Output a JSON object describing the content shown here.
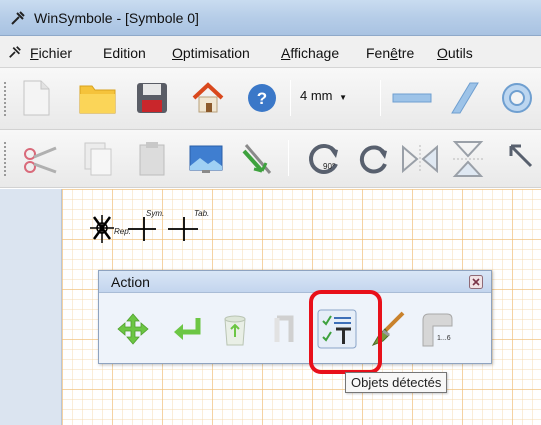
{
  "window": {
    "title": "WinSymbole - [Symbole 0]"
  },
  "menu": {
    "items": [
      {
        "label": "Fichier",
        "mnemonic_index": 0
      },
      {
        "label": "Edition",
        "mnemonic_index": -1
      },
      {
        "label": "Optimisation",
        "mnemonic_index": 0
      },
      {
        "label": "Affichage",
        "mnemonic_index": 0
      },
      {
        "label": "Fenêtre",
        "mnemonic_index": 3
      },
      {
        "label": "Outils",
        "mnemonic_index": 0
      }
    ]
  },
  "toolbar1": {
    "buttons": [
      "new-file-icon",
      "open-folder-icon",
      "save-floppy-icon",
      "home-icon",
      "help-icon"
    ],
    "dimension_select": "4 mm",
    "tools": [
      "horizontal-line-icon",
      "oblique-line-icon",
      "circle-icon"
    ]
  },
  "toolbar2": {
    "buttons": [
      "cut-scissors-icon",
      "copy-icon",
      "paste-icon",
      "image-icon",
      "resize-icon",
      "rotate-90-icon",
      "rotate-icon",
      "mirror-horizontal-icon",
      "mirror-vertical-icon",
      "arrow-icon"
    ]
  },
  "canvas": {
    "symbols": [
      {
        "name": "reference-point",
        "label": "Rep."
      },
      {
        "name": "symmetry-point",
        "label": "Sym."
      },
      {
        "name": "table-point",
        "label": "Tab."
      }
    ]
  },
  "action_window": {
    "title": "Action",
    "buttons": [
      {
        "name": "move-icon"
      },
      {
        "name": "enter-arrow-icon"
      },
      {
        "name": "recycle-bin-icon"
      },
      {
        "name": "export-icon"
      },
      {
        "name": "detected-objects-icon"
      },
      {
        "name": "brush-icon"
      },
      {
        "name": "numbering-icon",
        "label": "1...6"
      }
    ]
  },
  "tooltip": {
    "text": "Objets détectés"
  },
  "colors": {
    "highlight": "#e8101a",
    "titlebar": "#b6cde8",
    "grid": "#f0be78",
    "action_green": "#5cbf3a"
  }
}
